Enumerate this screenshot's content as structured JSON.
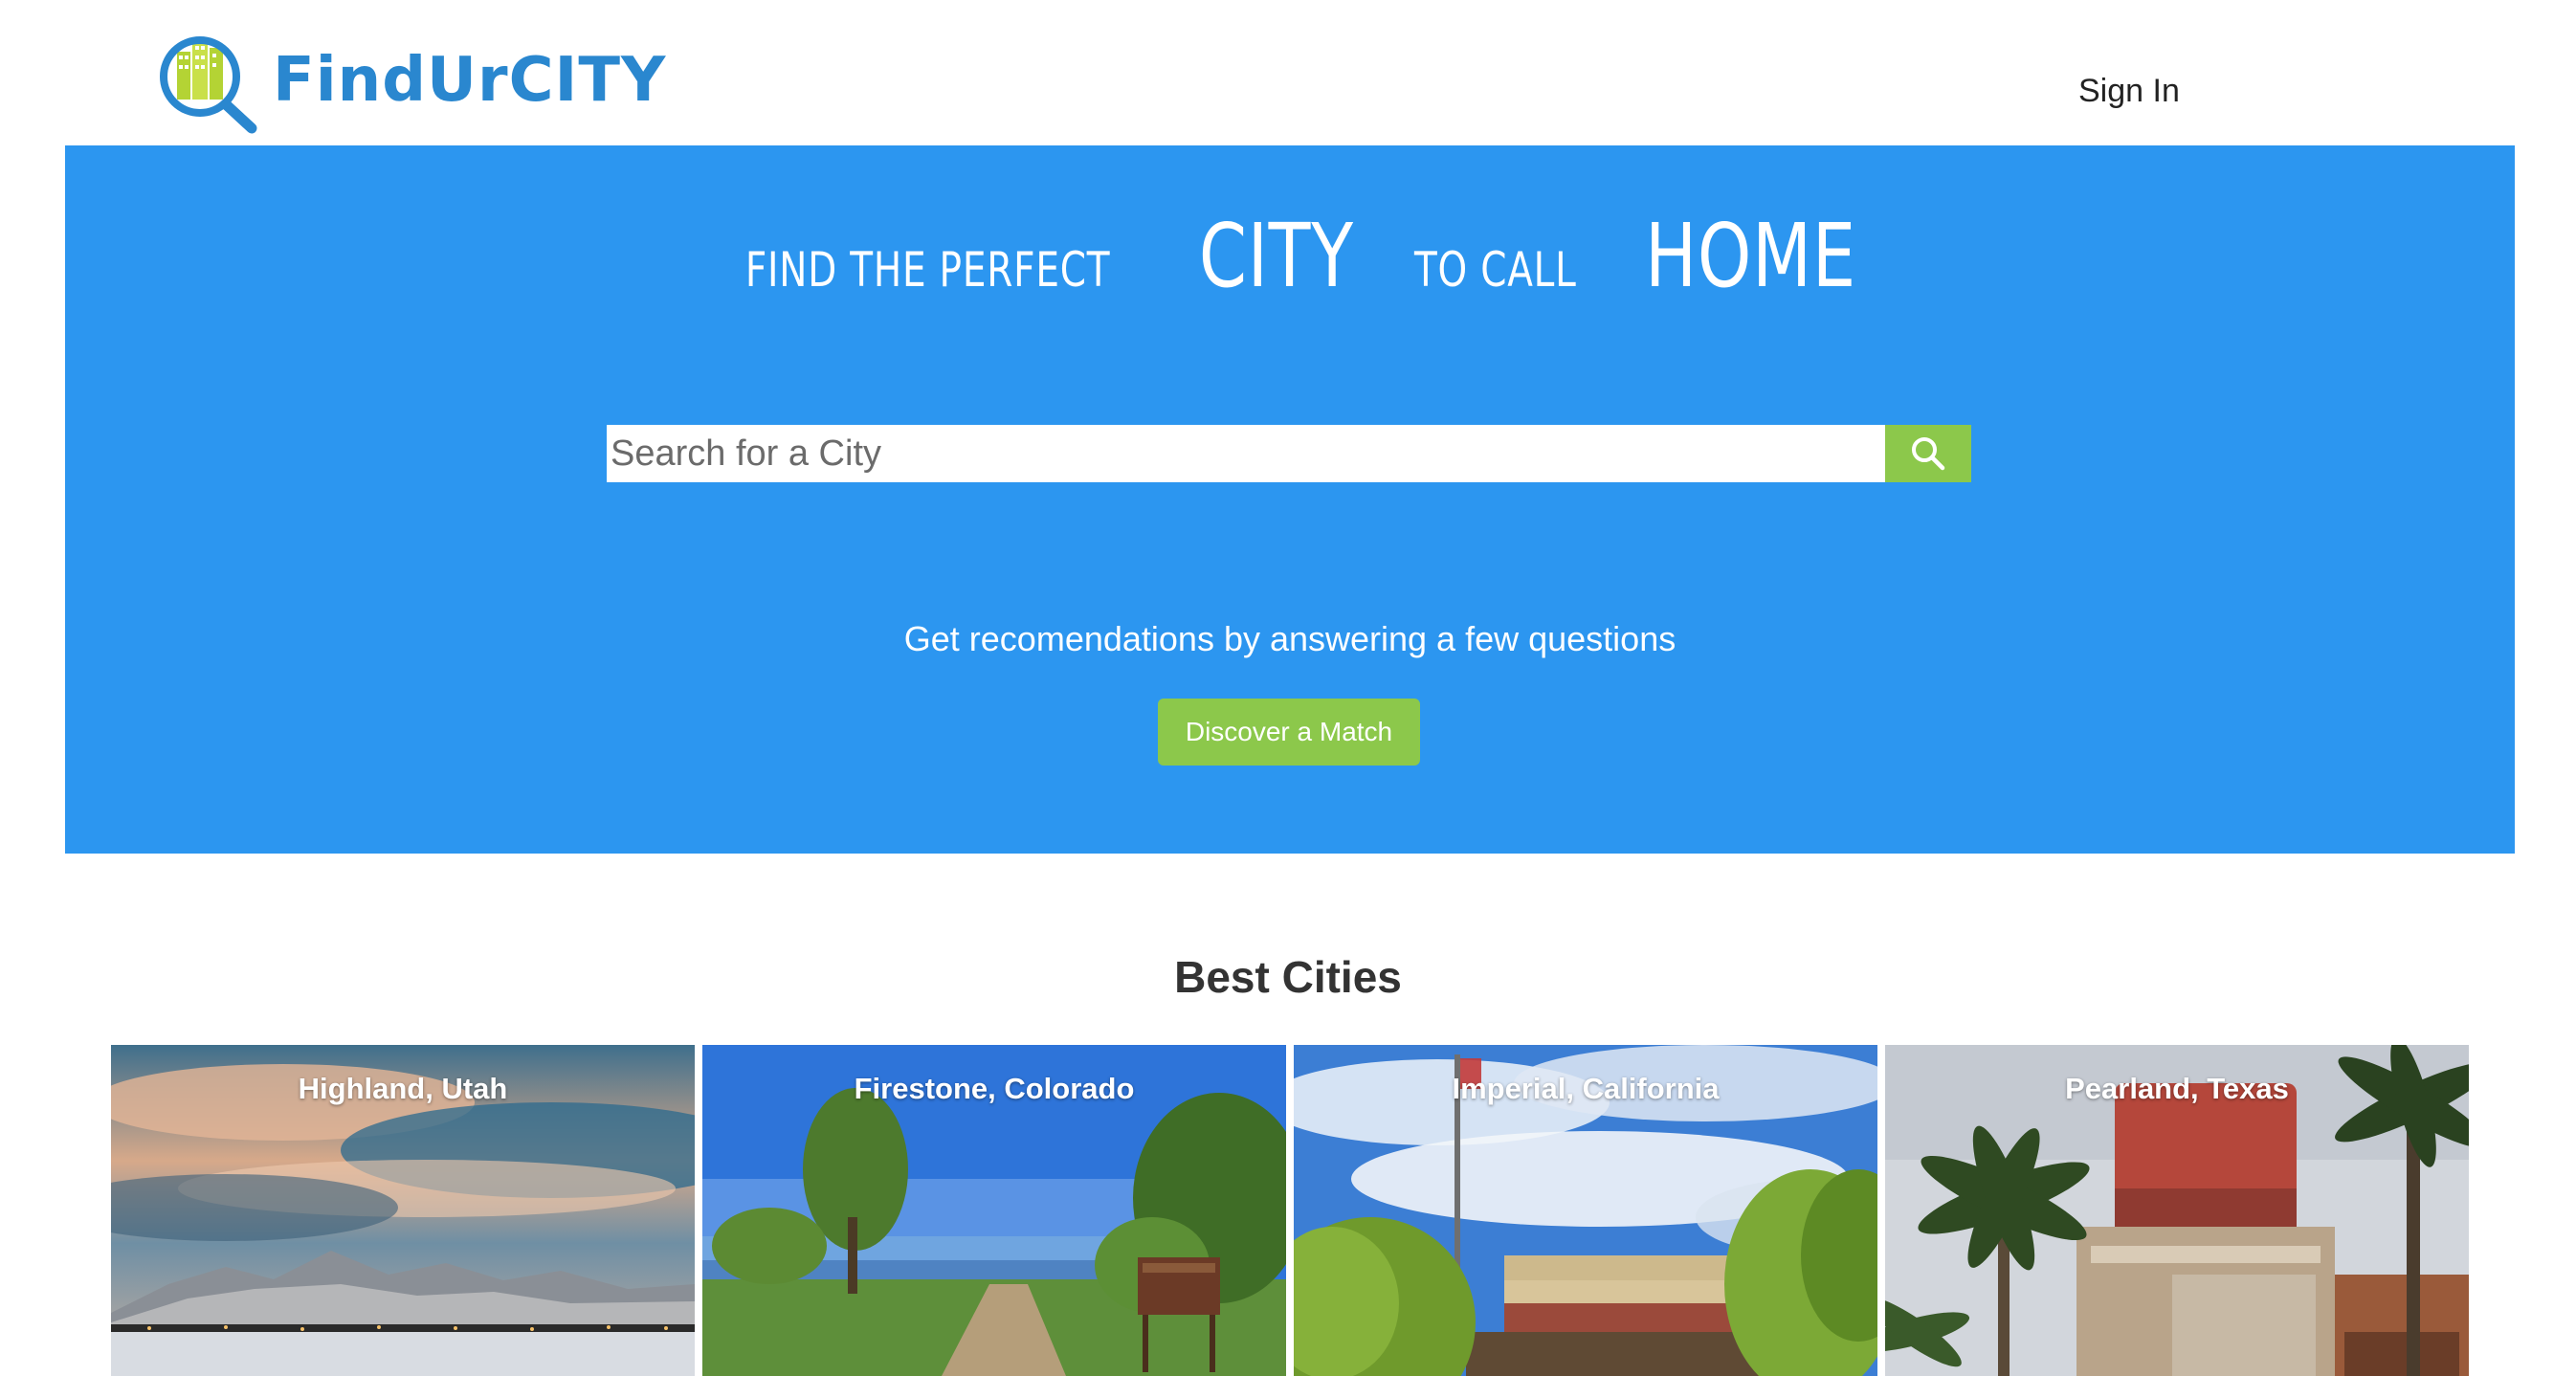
{
  "header": {
    "logo_text": "FindUrCITY",
    "signin_label": "Sign In"
  },
  "hero": {
    "headline": {
      "part1": "FIND THE PERFECT",
      "part2": "CITY",
      "part3": "TO CALL",
      "part4": "HOME"
    },
    "search": {
      "placeholder": "Search for a City",
      "value": ""
    },
    "cta_text": "Get recomendations by answering a few questions",
    "cta_button_label": "Discover a Match"
  },
  "best_cities": {
    "title": "Best Cities",
    "cities": [
      {
        "name": "Highland, Utah"
      },
      {
        "name": "Firestone, Colorado"
      },
      {
        "name": "Imperial, California"
      },
      {
        "name": "Pearland, Texas"
      }
    ]
  },
  "colors": {
    "hero_background": "#2c96f0",
    "accent_green": "#8cc84b",
    "logo_blue": "#2a87cf",
    "logo_green": "#b4d334"
  },
  "icons": {
    "logo": "magnifier-city-icon",
    "search": "search-icon"
  }
}
